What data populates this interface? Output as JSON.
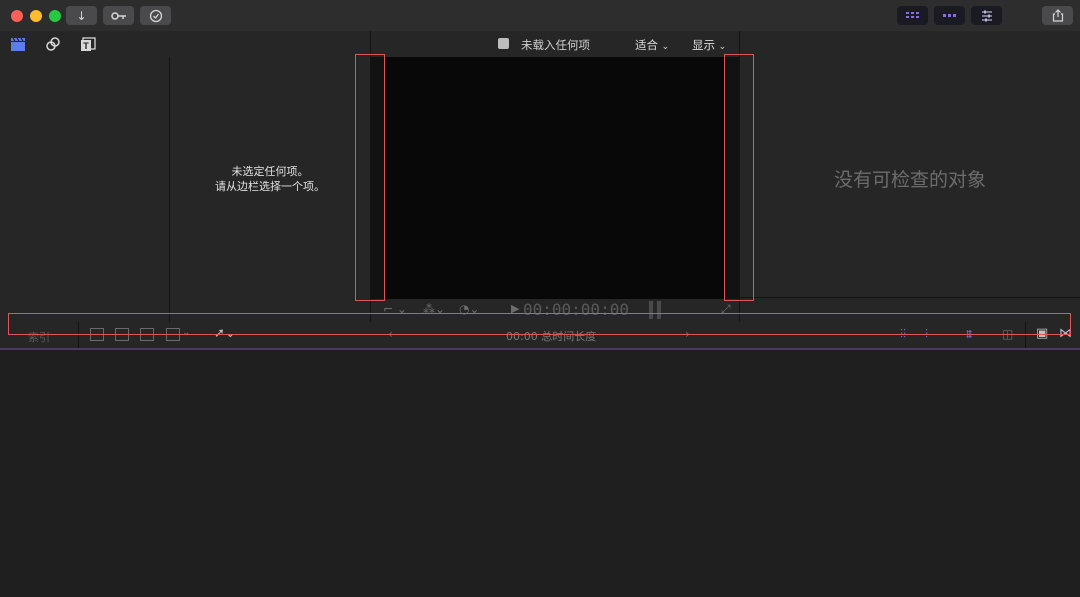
{
  "titlebar": {
    "import_icon": "download-arrow-icon",
    "keywords_icon": "key-icon",
    "background_tasks_icon": "check-circle-icon",
    "share_icon": "share-icon"
  },
  "sidebar": {
    "icons": [
      "clapper-icon",
      "music-photo-icon",
      "titles-icon"
    ]
  },
  "browser": {
    "empty_line1": "未选定任何项。",
    "empty_line2": "请从边栏选择一个项。"
  },
  "viewer": {
    "title": "未载入任何项",
    "fit_label": "适合",
    "display_label": "显示",
    "timecode": "00:00:00:00"
  },
  "inspector": {
    "empty_text": "没有可检查的对象"
  },
  "timeline": {
    "index_label": "索引",
    "duration_label": "00:00 总时间长度"
  },
  "colors": {
    "accent_purple": "#8a6de0",
    "highlight_red": "#e0555c"
  }
}
